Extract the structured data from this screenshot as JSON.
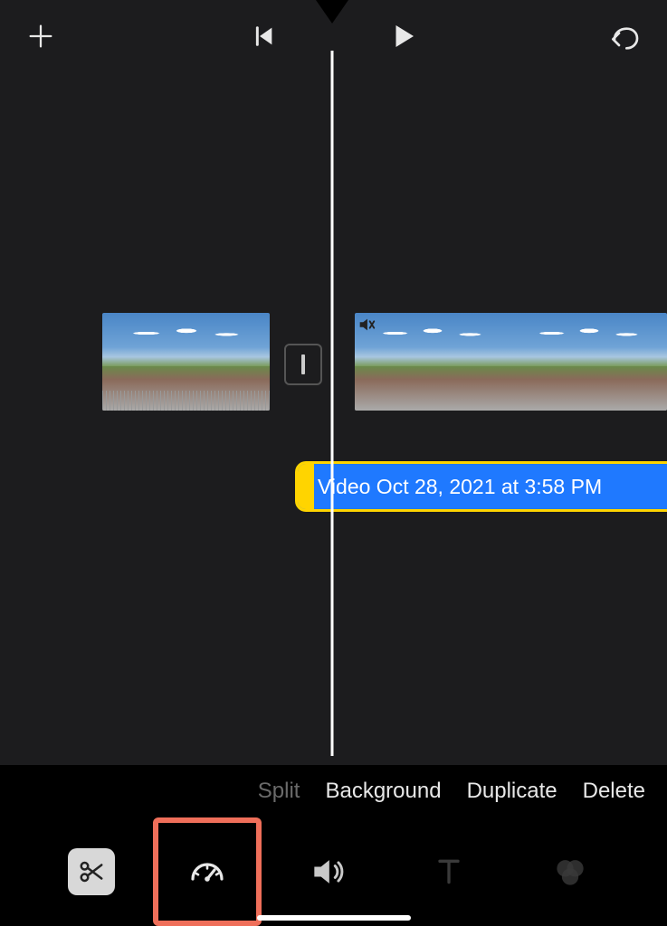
{
  "clip_label": "Video Oct 28, 2021 at 3:58 PM",
  "context_menu": {
    "split": "Split",
    "background": "Background",
    "duplicate": "Duplicate",
    "delete": "Delete"
  },
  "icons": {
    "add": "add-icon",
    "prev": "previous-icon",
    "play": "play-icon",
    "undo": "undo-icon",
    "mute": "mute-icon",
    "scissors": "scissors-icon",
    "speed": "speedometer-icon",
    "volume": "volume-icon",
    "text": "text-icon",
    "filters": "filters-icon"
  }
}
